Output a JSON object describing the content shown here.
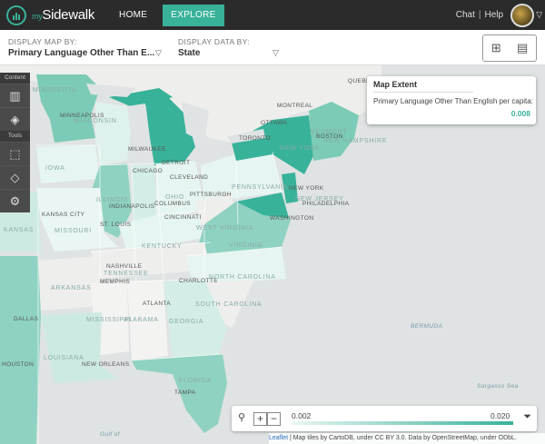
{
  "header": {
    "logo_prefix": "my",
    "logo_name": "Sidewalk",
    "nav_home": "HOME",
    "nav_explore": "EXPLORE",
    "chat": "Chat",
    "separator": "|",
    "help": "Help",
    "menu_caret": "▽"
  },
  "selectors": {
    "map_by_label": "DISPLAY MAP BY:",
    "map_by_value": "Primary Language Other Than E...",
    "data_by_label": "DISPLAY DATA BY:",
    "data_by_value": "State",
    "caret": "▽"
  },
  "side_panel": {
    "content_label": "Content",
    "tools_label": "Tools"
  },
  "popup": {
    "title": "Map Extent",
    "description": "Primary Language Other Than English per capita:",
    "value": "0.008"
  },
  "legend": {
    "min": "0.002",
    "max": "0.020"
  },
  "attribution": {
    "leaflet": "Leaflet",
    "text": " | Map tiles by CartoDB, under CC BY 3.0. Data by OpenStreetMap, under ODbL."
  },
  "map_labels": {
    "cities": [
      "MINNEAPOLIS",
      "MILWAUKEE",
      "DETROIT",
      "CHICAGO",
      "CLEVELAND",
      "PITTSBURGH",
      "COLUMBUS",
      "INDIANAPOLIS",
      "CINCINNATI",
      "ST. LOUIS",
      "KANSAS CITY",
      "NASHVILLE",
      "MEMPHIS",
      "CHARLOTTE",
      "ATLANTA",
      "DALLAS",
      "HOUSTON",
      "NEW ORLEANS",
      "TAMPA",
      "TORONTO",
      "MONTREAL",
      "QUEBEC",
      "OTTAWA",
      "BOSTON",
      "NEW YORK",
      "PHILADELPHIA",
      "WASHINGTON"
    ],
    "states": [
      "MINNESOTA",
      "WISCONSIN",
      "IOWA",
      "ILLINOIS",
      "MISSOURI",
      "KANSAS",
      "KENTUCKY",
      "TENNESSEE",
      "ARKANSAS",
      "MISSISSIPPI",
      "ALABAMA",
      "GEORGIA",
      "NORTH CAROLINA",
      "SOUTH CAROLINA",
      "VIRGINIA",
      "WEST VIRGINIA",
      "PENNSYLVANIA",
      "OHIO",
      "NEW YORK",
      "VERMONT",
      "NEW HAMPSHIRE",
      "FLORIDA",
      "LOUISIANA",
      "NEW JERSEY"
    ],
    "water": [
      "BERMUDA",
      "Sargasso Sea",
      "Gulf of"
    ]
  },
  "colors": {
    "accent": "#39b29a",
    "topbar": "#2b2b2b",
    "panel": "#3b3b3b"
  }
}
